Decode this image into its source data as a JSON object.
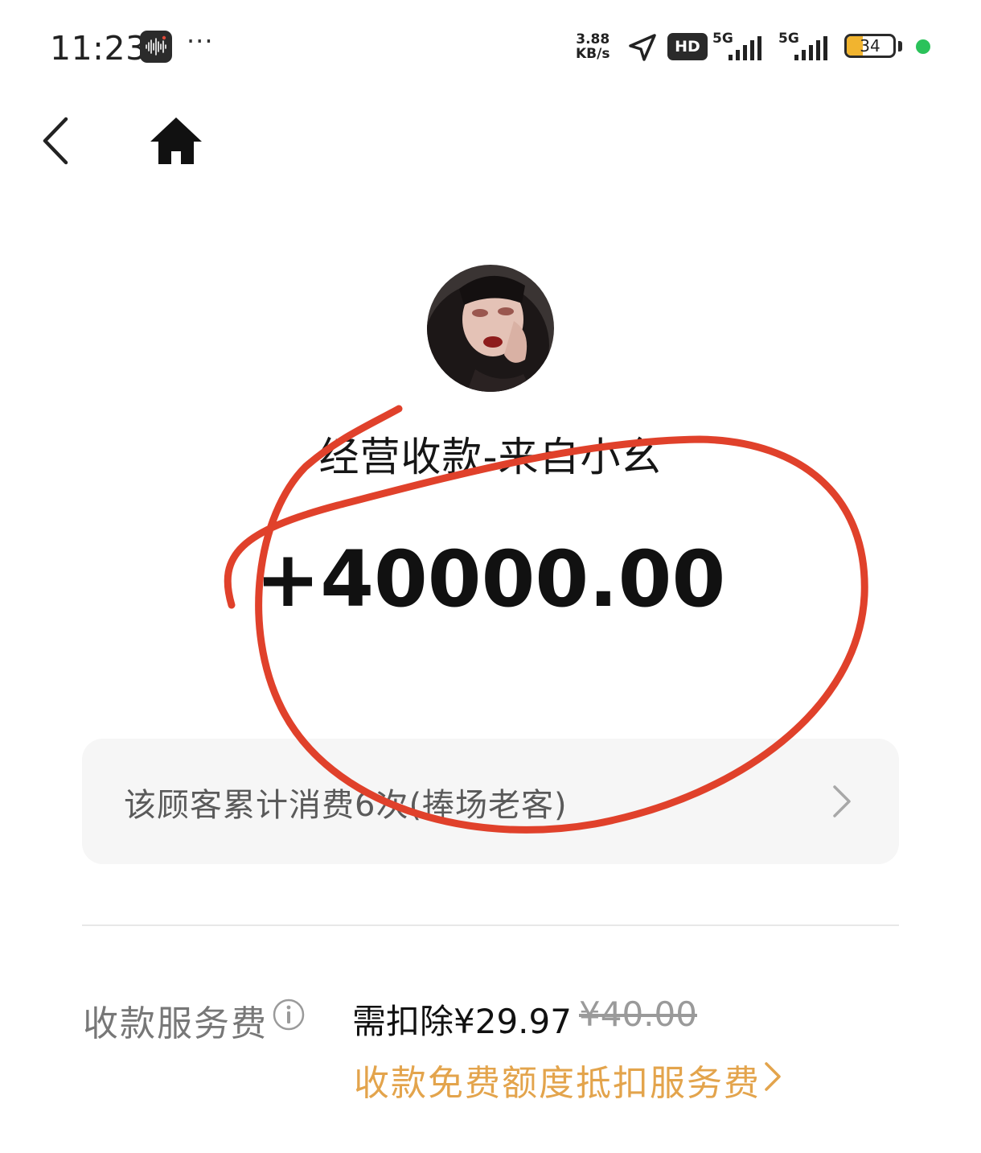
{
  "status_bar": {
    "time": "11:23",
    "more": "···",
    "net_speed_value": "3.88",
    "net_speed_unit": "KB/s",
    "hd_label": "HD",
    "sim1_label": "5G",
    "sim2_label": "5G",
    "battery_level": "34",
    "battery_fraction": 0.34,
    "active_dot_color": "#2bc25a"
  },
  "nav": {
    "back_icon": "chevron-left-icon",
    "home_icon": "home-icon"
  },
  "payment": {
    "title": "经营收款-来自小幺",
    "amount": "+40000.00"
  },
  "customer_card": {
    "text": "该顾客累计消费6次(捧场老客)"
  },
  "fee": {
    "label": "收款服务费",
    "value": "需扣除¥29.97",
    "original": "¥40.00",
    "promo": "收款免费额度抵扣服务费"
  },
  "colors": {
    "accent_orange": "#e3a44c",
    "annotation_red": "#e0412b",
    "battery_yellow": "#f1b42f"
  }
}
